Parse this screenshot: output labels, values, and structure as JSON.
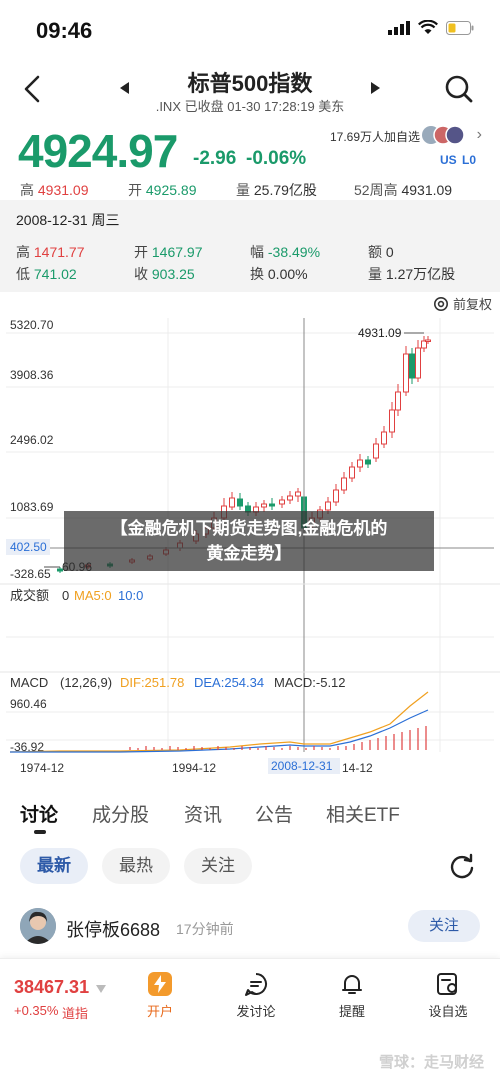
{
  "status": {
    "time": "09:46"
  },
  "nav": {
    "title": "标普500指数",
    "subtitle": ".INX  已收盘 01-30 17:28:19 美东"
  },
  "quote": {
    "price": "4924.97",
    "change": "-2.96",
    "change_pct": "-0.06%",
    "followers": "17.69万人加自选",
    "badge_us": "US",
    "badge_l0": "L0",
    "high_label": "高",
    "high": "4931.09",
    "open_label": "开",
    "open": "4925.89",
    "vol_label": "量",
    "vol": "25.79亿股",
    "w52_label": "52周高",
    "w52": "4931.09"
  },
  "detail": {
    "date": "2008-12-31 周三",
    "high_label": "高",
    "high": "1471.77",
    "open_label": "开",
    "open": "1467.97",
    "amp_label": "幅",
    "amp": "-38.49%",
    "amt_label": "额",
    "amt": "0",
    "low_label": "低",
    "low": "741.02",
    "close_label": "收",
    "close": "903.25",
    "turn_label": "换",
    "turn": "0.00%",
    "vol_label": "量",
    "vol": "1.27万亿股"
  },
  "chart": {
    "restore_label": "前复权",
    "y_ticks": [
      "5320.70",
      "3908.36",
      "2496.02",
      "1083.69",
      "402.50",
      "-328.65"
    ],
    "max_label": "4931.09",
    "min_label": "60.96",
    "vol_title": "成交额",
    "vol_value": "0",
    "ma5_label": "MA5:0",
    "ma10_label": "10:0",
    "macd_title": "MACD",
    "macd_params": "(12,26,9)",
    "dif_label": "DIF:251.78",
    "dea_label": "DEA:254.34",
    "macd_label": "MACD:-5.12",
    "macd_top": "960.46",
    "macd_bottom": "-36.92",
    "x_labels": [
      "1974-12",
      "1994-12",
      "2008-12-31",
      "14-12"
    ],
    "colors": {
      "up": "#e04040",
      "down": "#1a9a6a",
      "dif": "#f0a020",
      "dea": "#2b6fd6"
    }
  },
  "overlay": {
    "line1": "【金融危机下期货走势图,金融危机的",
    "line2": "黄金走势】"
  },
  "tabs": [
    "讨论",
    "成分股",
    "资讯",
    "公告",
    "相关ETF"
  ],
  "subtabs": [
    "最新",
    "最热",
    "关注"
  ],
  "post": {
    "user": "张停板6688",
    "time": "17分钟前",
    "follow": "关注"
  },
  "bottom": {
    "ticker_value": "38467.31",
    "ticker_pct": "+0.35%",
    "ticker_name": "道指",
    "items": [
      "开户",
      "发讨论",
      "提醒",
      "设自选"
    ],
    "watermark": "雪球：走马财经"
  }
}
